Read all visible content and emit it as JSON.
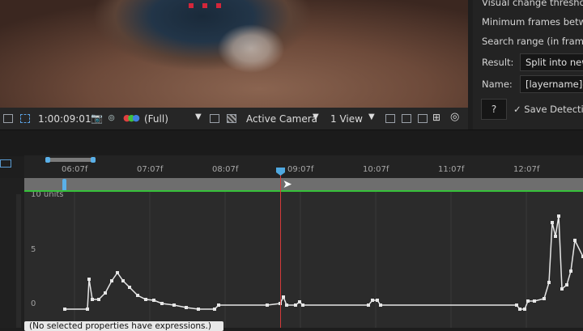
{
  "right_panel": {
    "row1": "Visual change threshold",
    "row2": "Minimum frames betwee",
    "row3": "Search range (in frames)",
    "result_label": "Result:",
    "result_value": "Split into new",
    "name_label": "Name:",
    "name_value": "[layername]-cl",
    "help_label": "?",
    "save_label": "Save Detection"
  },
  "viewer_toolbar": {
    "timecode": "1:00:09:01",
    "resolution": "(Full)",
    "camera": "Active Camera",
    "views": "1 View"
  },
  "timeline": {
    "ticks": [
      "06:07f",
      "07:07f",
      "08:07f",
      "09:07f",
      "10:07f",
      "11:07f",
      "12:07f"
    ],
    "units_label": "10 units",
    "y_labels": [
      "5",
      "0"
    ],
    "status": "(No selected properties have expressions.)"
  },
  "colors": {
    "playhead": "#d43a3a",
    "playhead_marker": "#4fa8e0",
    "green_line": "#36c13a",
    "curve": "#e6e6e6"
  },
  "icons": [
    "region-icon",
    "camera-icon",
    "channels-icon",
    "color-icon",
    "grid-icon",
    "transparency-icon",
    "dropdown-icon",
    "render-icon",
    "flowchart-icon",
    "exposure-icon"
  ]
}
